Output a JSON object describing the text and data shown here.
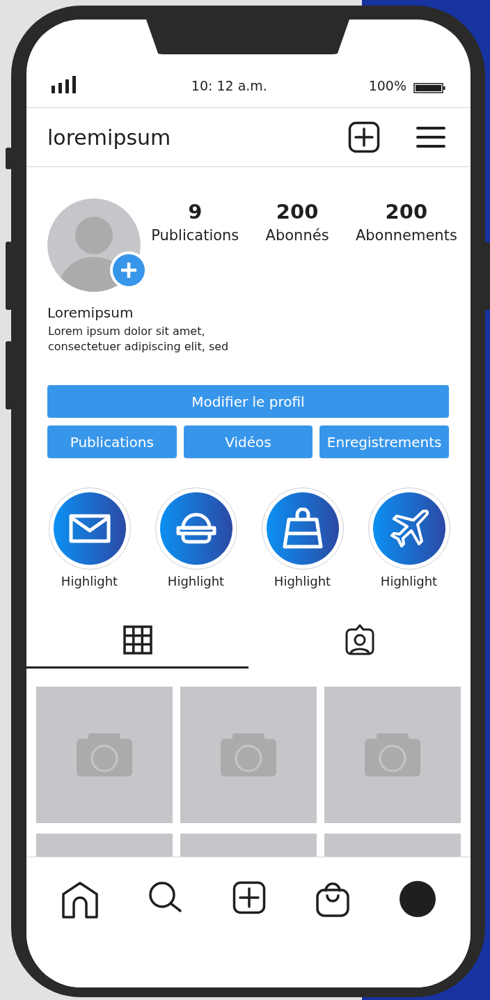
{
  "status_bar": {
    "time": "10: 12 a.m.",
    "battery": "100%"
  },
  "header": {
    "username": "loremipsum"
  },
  "profile": {
    "stats": [
      {
        "value": "9",
        "label": "Publications"
      },
      {
        "value": "200",
        "label": "Abonnés"
      },
      {
        "value": "200",
        "label": "Abonnements"
      }
    ],
    "name": "Loremipsum",
    "bio": "Lorem ipsum dolor sit amet,\nconsectetuer adipiscing elit, sed"
  },
  "edit_button": "Modifier le profil",
  "section_buttons": [
    "Publications",
    "Vidéos",
    "Enregistrements"
  ],
  "highlights": [
    {
      "label": "Highlight",
      "kind": "mail"
    },
    {
      "label": "Highlight",
      "kind": "burger"
    },
    {
      "label": "Highlight",
      "kind": "bag"
    },
    {
      "label": "Highlight",
      "kind": "plane"
    }
  ],
  "content_tabs": [
    {
      "kind": "grid",
      "selected": true
    },
    {
      "kind": "tagged",
      "selected": false
    }
  ],
  "posts": [
    {
      "kind": "placeholder"
    },
    {
      "kind": "placeholder"
    },
    {
      "kind": "placeholder"
    },
    {
      "kind": "cropped"
    },
    {
      "kind": "cropped"
    },
    {
      "kind": "cropped"
    }
  ],
  "bottom_nav": [
    {
      "kind": "home"
    },
    {
      "kind": "search"
    },
    {
      "kind": "add"
    },
    {
      "kind": "shop"
    },
    {
      "kind": "profile"
    }
  ]
}
